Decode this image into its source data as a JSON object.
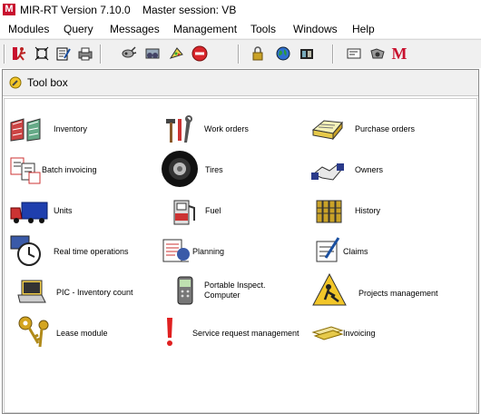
{
  "app": {
    "title": "MIR-RT Version 7.10.0    Master session: VB",
    "logo_text": "M"
  },
  "menu": [
    "Modules",
    "Query",
    "Messages",
    "Management",
    "Tools",
    "Windows",
    "Help"
  ],
  "toolbar": {
    "buttons": [
      "runner-icon",
      "resize-icon",
      "edit-form-icon",
      "printer-icon",
      "tools-gear-icon",
      "glasses-icon",
      "palette-icon",
      "stop-icon",
      "lock-icon",
      "globe-icon",
      "filmstrip-icon",
      "message-icon",
      "camera-icon",
      "m-logo-icon"
    ],
    "m_logo_text": "M"
  },
  "window": {
    "title": "Tool box"
  },
  "tools": [
    {
      "label": "Inventory",
      "icon": "inventory-icon"
    },
    {
      "label": "Work orders",
      "icon": "tools-icon"
    },
    {
      "label": "Purchase orders",
      "icon": "purchase-orders-icon"
    },
    {
      "label": "Batch invoicing",
      "icon": "batch-invoicing-icon"
    },
    {
      "label": "Tires",
      "icon": "tire-icon"
    },
    {
      "label": "Owners",
      "icon": "handshake-icon"
    },
    {
      "label": "Units",
      "icon": "truck-icon"
    },
    {
      "label": "Fuel",
      "icon": "fuel-pump-icon"
    },
    {
      "label": "History",
      "icon": "history-binders-icon"
    },
    {
      "label": "Real time operations",
      "icon": "clock-icon"
    },
    {
      "label": "Planning",
      "icon": "planning-icon"
    },
    {
      "label": "Claims",
      "icon": "claims-icon"
    },
    {
      "label": "PIC - Inventory count",
      "icon": "inventory-count-icon"
    },
    {
      "label": "Portable Inspect.\nComputer",
      "icon": "handheld-computer-icon"
    },
    {
      "label": "Projects management",
      "icon": "construction-sign-icon"
    },
    {
      "label": "Lease module",
      "icon": "keys-icon"
    },
    {
      "label": "Service request management",
      "icon": "exclamation-icon"
    },
    {
      "label": "Invoicing",
      "icon": "invoice-icon"
    }
  ]
}
